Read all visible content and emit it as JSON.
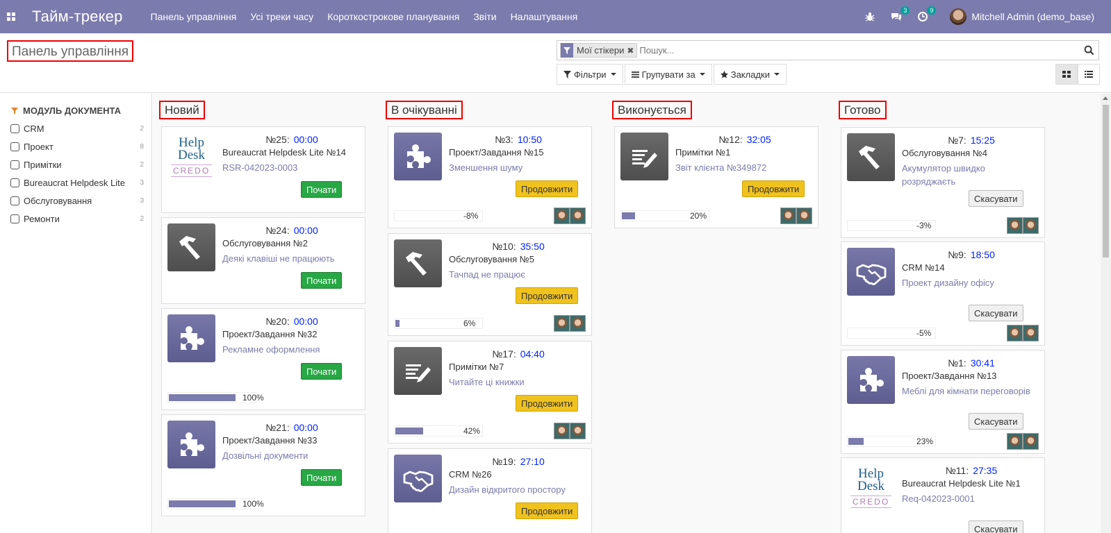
{
  "nav": {
    "app_title": "Тайм-трекер",
    "menu": [
      "Панель управління",
      "Усі треки часу",
      "Короткострокове планування",
      "Звіти",
      "Налаштування"
    ],
    "messages_badge": "3",
    "activities_badge": "9",
    "user_name": "Mitchell Admin (demo_base)"
  },
  "control": {
    "page_title": "Панель управління",
    "facet_label": "Мої стікери",
    "search_placeholder": "Пошук...",
    "filters_label": "Фільтри",
    "groupby_label": "Групувати за",
    "favorites_label": "Закладки"
  },
  "sidebar": {
    "header": "МОДУЛЬ ДОКУМЕНТА",
    "items": [
      {
        "label": "CRM",
        "count": "2"
      },
      {
        "label": "Проект",
        "count": "8"
      },
      {
        "label": "Примітки",
        "count": "2"
      },
      {
        "label": "Bureaucrat Helpdesk Lite",
        "count": "3"
      },
      {
        "label": "Обслуговування",
        "count": "3"
      },
      {
        "label": "Ремонти",
        "count": "2"
      }
    ]
  },
  "columns": [
    "Новий",
    "В очікуванні",
    "Виконується",
    "Готово"
  ],
  "cards": [
    {
      "num": "№25:",
      "time": "00:00",
      "sub": "Bureaucrat Helpdesk Lite №14",
      "desc": "RSR-042023-0003",
      "button": "Почати",
      "icon": "helpdesk-logo-icon",
      "logo_top": "Help",
      "logo_bottom": "Desk",
      "logo_sub": "CREDO"
    },
    {
      "num": "№24:",
      "time": "00:00",
      "sub": "Обслуговування №2",
      "desc": "Деякі клавіші не працюють",
      "button": "Почати",
      "icon": "hammer-icon"
    },
    {
      "num": "№20:",
      "time": "00:00",
      "sub": "Проект/Завдання №32",
      "desc": "Рекламне оформлення",
      "button": "Почати",
      "icon": "puzzle-icon",
      "progress": 100,
      "progress_label": "100%"
    },
    {
      "num": "№21:",
      "time": "00:00",
      "sub": "Проект/Завдання №33",
      "desc": "Дозвільні документи",
      "button": "Почати",
      "icon": "puzzle-icon",
      "progress": 100,
      "progress_label": "100%"
    },
    {
      "num": "№3:",
      "time": "10:50",
      "sub": "Проект/Завдання №15",
      "desc": "Зменшення шуму",
      "button": "Продовжити",
      "icon": "puzzle-icon",
      "progress": 0,
      "progress_label": "-8%"
    },
    {
      "num": "№10:",
      "time": "35:50",
      "sub": "Обслуговування №5",
      "desc": "Тачпад не працює",
      "button": "Продовжити",
      "icon": "hammer-icon",
      "progress": 6,
      "progress_label": "6%"
    },
    {
      "num": "№17:",
      "time": "04:40",
      "sub": "Примітки №7",
      "desc": "Читайте ці книжки",
      "button": "Продовжити",
      "icon": "note-pencil-icon",
      "progress": 42,
      "progress_label": "42%"
    },
    {
      "num": "№19:",
      "time": "27:10",
      "sub": "CRM №26",
      "desc": "Дизайн відкритого простору",
      "button": "Продовжити",
      "icon": "handshake-icon"
    },
    {
      "num": "№12:",
      "time": "32:05",
      "sub": "Примітки №1",
      "desc": "Звіт клієнта №349872",
      "button": "Продовжити",
      "icon": "note-pencil-icon",
      "progress": 20,
      "progress_label": "20%"
    },
    {
      "num": "№7:",
      "time": "15:25",
      "sub": "Обслуговування №4",
      "desc": "Акумулятор швидко розряджаєть",
      "button": "Скасувати",
      "icon": "hammer-icon",
      "progress": 0,
      "progress_label": "-3%"
    },
    {
      "num": "№9:",
      "time": "18:50",
      "sub": "CRM №14",
      "desc": "Проект дизайну офісу",
      "button": "Скасувати",
      "icon": "handshake-icon",
      "progress": 0,
      "progress_label": "-5%"
    },
    {
      "num": "№1:",
      "time": "30:41",
      "sub": "Проект/Завдання №13",
      "desc": "Меблі для кімнати переговорів",
      "button": "Скасувати",
      "icon": "puzzle-icon",
      "progress": 23,
      "progress_label": "23%"
    },
    {
      "num": "№11:",
      "time": "27:35",
      "sub": "Bureaucrat Helpdesk Lite №1",
      "desc": "Req-042023-0001",
      "button": "Скасувати",
      "icon": "helpdesk-logo-icon",
      "logo_top": "Help",
      "logo_bottom": "Desk",
      "logo_sub": "CREDO"
    }
  ]
}
